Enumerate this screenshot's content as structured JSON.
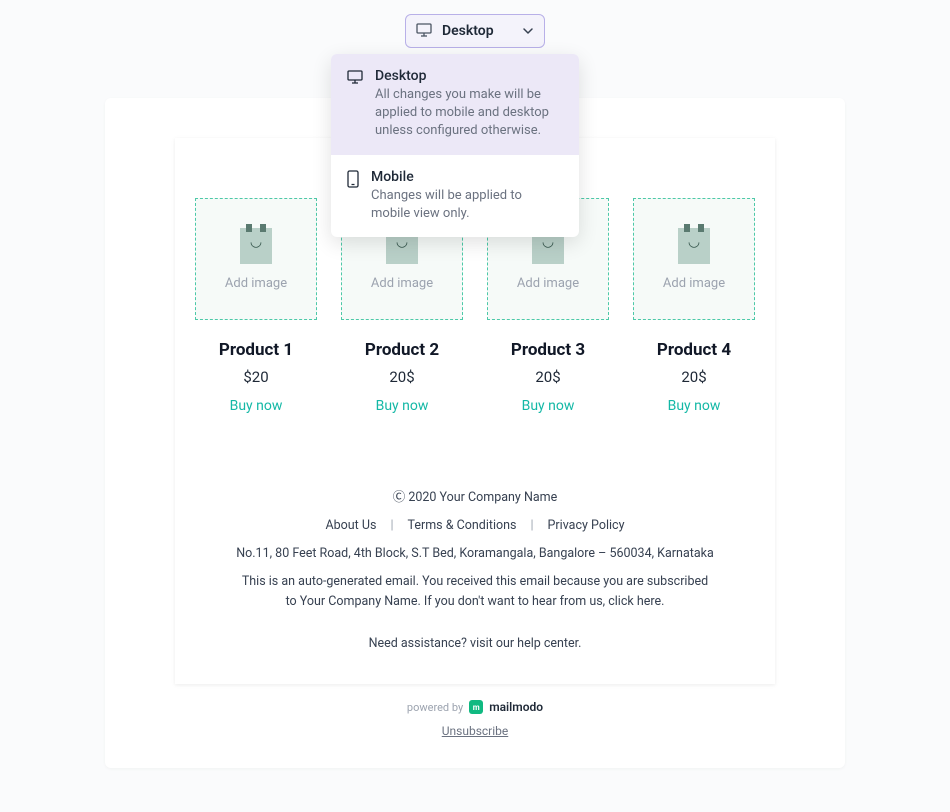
{
  "deviceSelector": {
    "label": "Desktop",
    "options": [
      {
        "title": "Desktop",
        "desc": "All changes you make will be applied to mobile and desktop unless configured otherwise.",
        "selected": true
      },
      {
        "title": "Mobile",
        "desc": "Changes will be applied to mobile view only.",
        "selected": false
      }
    ]
  },
  "products": [
    {
      "placeholder": "Add image",
      "name": "Product 1",
      "price": "$20",
      "cta": "Buy now"
    },
    {
      "placeholder": "Add image",
      "name": "Product 2",
      "price": "20$",
      "cta": "Buy now"
    },
    {
      "placeholder": "Add image",
      "name": "Product 3",
      "price": "20$",
      "cta": "Buy now"
    },
    {
      "placeholder": "Add image",
      "name": "Product 4",
      "price": "20$",
      "cta": "Buy now"
    }
  ],
  "footer": {
    "copyright": "Ⓒ 2020 Your Company Name",
    "links": [
      {
        "label": "About Us"
      },
      {
        "label": "Terms & Conditions"
      },
      {
        "label": "Privacy Policy"
      }
    ],
    "address": "No.11, 80 Feet Road, 4th Block, S.T Bed, Koramangala, Bangalore – 560034, Karnataka",
    "note": "This is an auto-generated email. You received this email because you are subscribed to Your Company Name. If you don't want to hear from us, click here.",
    "help": "Need assistance? visit our help center."
  },
  "powered": {
    "prefix": "powered by",
    "brand": "mailmodo"
  },
  "unsubscribe": "Unsubscribe"
}
